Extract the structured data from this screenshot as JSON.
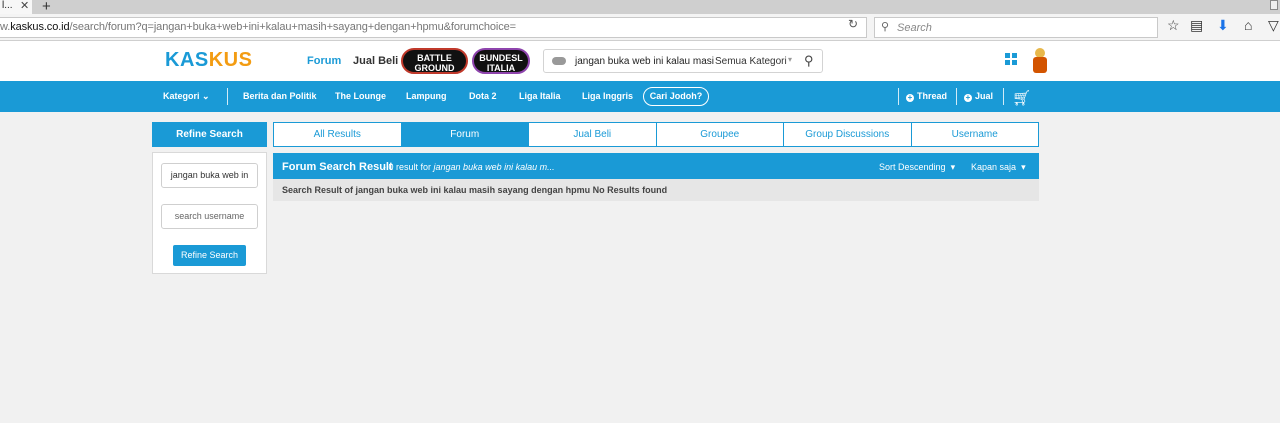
{
  "browser": {
    "tab_label": "l...",
    "tab_close": "✕",
    "new_tab": "+",
    "url_prefix": "w.",
    "url_domain": "kaskus.co.id",
    "url_path": "/search/forum?q=jangan+buka+web+ini+kalau+masih+sayang+dengan+hpmu&forumchoice=",
    "search_placeholder": "Search",
    "icons": [
      "reload-icon",
      "search-icon",
      "star-icon",
      "clipboard-icon",
      "download-icon",
      "home-icon",
      "pocket-icon"
    ]
  },
  "header": {
    "logo_part1": "KAS",
    "logo_part2": "KUS",
    "nav_forum": "Forum",
    "nav_jual_beli": "Jual Beli",
    "promo_battleground": "BATTLE GROUND",
    "promo_liga": "BUNDESL ITALIA",
    "search_query": "jangan buka web ini kalau masi",
    "search_category": "Semua Kategori",
    "colors": {
      "brand_blue": "#1a9ad6",
      "brand_orange": "#f39c12"
    }
  },
  "navbar": {
    "kategori": "Kategori",
    "items": [
      "Berita dan Politik",
      "The Lounge",
      "Lampung",
      "Dota 2",
      "Liga Italia",
      "Liga Inggris"
    ],
    "cari_jodoh": "Cari Jodoh?",
    "thread": "Thread",
    "jual": "Jual"
  },
  "refine": {
    "title": "Refine Search",
    "query_value": "jangan buka web in",
    "username_placeholder": "search username",
    "button": "Refine Search"
  },
  "tabs": [
    {
      "label": "All Results",
      "active": false
    },
    {
      "label": "Forum",
      "active": true
    },
    {
      "label": "Jual Beli",
      "active": false
    },
    {
      "label": "Groupee",
      "active": false
    },
    {
      "label": "Group Discussions",
      "active": false
    },
    {
      "label": "Username",
      "active": false
    }
  ],
  "results": {
    "title": "Forum Search Result",
    "count_text": "- 0 result for",
    "count_query": "jangan buka web ini kalau m...",
    "sort": "Sort Descending",
    "time": "Kapan saja",
    "message": "Search Result of jangan buka web ini kalau masih sayang dengan hpmu No Results found"
  }
}
